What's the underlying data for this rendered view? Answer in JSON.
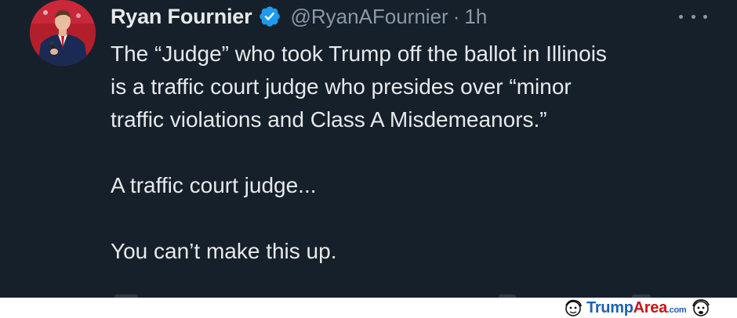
{
  "tweet": {
    "author_name": "Ryan Fournier",
    "handle": "@RyanAFournier",
    "separator": "·",
    "time": "1h",
    "lines": [
      "The “Judge” who took Trump off the ballot in Illinois",
      "is a traffic court judge who presides over “minor",
      "traffic violations and Class A Misdemeanors.”",
      "",
      "A traffic court judge...",
      "",
      "You can’t make this up."
    ],
    "icons": {
      "verified": "verified-badge-icon",
      "more": "more-options-icon"
    }
  },
  "watermark": {
    "brand_first": "Trump",
    "brand_second": "Area",
    "suffix": ".com"
  },
  "colors": {
    "background": "#16202b",
    "primary_text": "#e7e9ea",
    "secondary_text": "#8b98a5",
    "verified_blue": "#1d9bf0",
    "watermark_blue": "#1f5fb8",
    "watermark_red": "#c4161c"
  }
}
